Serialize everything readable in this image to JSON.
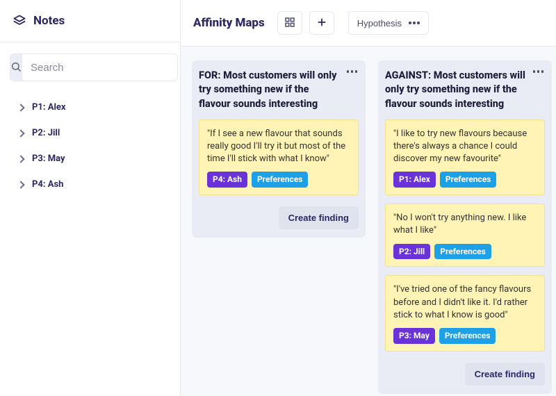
{
  "sidebar": {
    "title": "Notes",
    "search_placeholder": "Search",
    "items": [
      {
        "label": "P1: Alex"
      },
      {
        "label": "P2: Jill"
      },
      {
        "label": "P3: May"
      },
      {
        "label": "P4: Ash"
      }
    ]
  },
  "header": {
    "title": "Affinity Maps",
    "grid_icon": "grid-icon",
    "plus_icon": "plus-icon",
    "chip_label": "Hypothesis"
  },
  "columns": [
    {
      "title": "FOR: Most customers will only try something new if the flavour sounds interesting",
      "notes": [
        {
          "text": "\"If I see a new flavour that sounds really good I'll try it but most of the time I'll stick with what I know\"",
          "person": "P4: Ash",
          "topic": "Preferences"
        }
      ],
      "action": "Create finding"
    },
    {
      "title": "AGAINST: Most customers will only try something new if the flavour sounds interesting",
      "notes": [
        {
          "text": "\"I like to try new flavours because there's always a chance I could discover my new favourite\"",
          "person": "P1: Alex",
          "topic": "Preferences"
        },
        {
          "text": "\"No I won't try anything new. I like what I like\"",
          "person": "P2: Jill",
          "topic": "Preferences"
        },
        {
          "text": "\"I've tried one of the fancy flavours before and I didn't like it. I'd rather stick to what I know is good\"",
          "person": "P3: May",
          "topic": "Preferences"
        }
      ],
      "action": "Create finding"
    }
  ]
}
